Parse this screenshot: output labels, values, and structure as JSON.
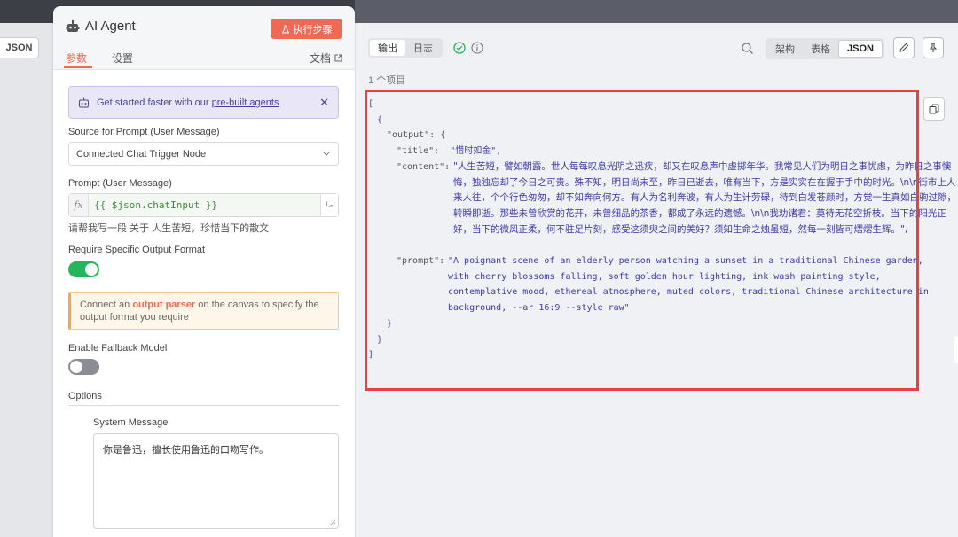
{
  "side_left": {
    "json_label": "JSON"
  },
  "panel": {
    "title": "AI Agent",
    "exec_button": "执行步骤",
    "tabs": {
      "params": "参数",
      "settings": "设置"
    },
    "docs_link": "文档",
    "tip": {
      "prefix": "Get started faster with our ",
      "link": "pre-built agents"
    },
    "source_label": "Source for Prompt (User Message)",
    "source_value": "Connected Chat Trigger Node",
    "prompt_label": "Prompt (User Message)",
    "prompt_expr": "{{ $json.chatInput }}",
    "prompt_hint": "请帮我写一段 关于 人生苦短，珍惜当下的散文",
    "require_format_label": "Require Specific Output Format",
    "require_format_on": true,
    "warn": {
      "p1": "Connect an ",
      "hl": "output parser",
      "p2": " on the canvas to specify the output format you require"
    },
    "fallback_label": "Enable Fallback Model",
    "fallback_on": false,
    "options_label": "Options",
    "system_message_label": "System Message",
    "system_message_value": "你是鲁迅，擅长使用鲁迅的口吻写作。"
  },
  "output": {
    "tabs": [
      "输出",
      "日志"
    ],
    "views": [
      "架构",
      "表格",
      "JSON"
    ],
    "active_view": "JSON",
    "item_count": "1 个项目",
    "json": {
      "open_bracket": "[",
      "open_brace": "{",
      "output_key": "\"output\": {",
      "title_key": "\"title\":",
      "title_val": "\"惜时如金\",",
      "content_key": "\"content\":",
      "content_val": "\"人生苦短，譬如朝露。世人每每叹息光阴之迅疾，却又在叹息声中虚掷年华。我常见人们为明日之事忧虑，为昨日之事懊悔，独独忘却了今日之可贵。殊不知，明日尚未至，昨日已逝去，唯有当下，方是实实在在握于手中的时光。\\n\\n街市上人来人往，个个行色匆匆，却不知奔向何方。有人为名利奔波，有人为生计劳碌，待到白发苍颜时，方觉一生真如白驹过隙，转瞬即逝。那些未曾欣赏的花开，未曾细品的茶香，都成了永远的遗憾。\\n\\n我劝诸君：莫待无花空折枝。当下的阳光正好，当下的微风正柔，何不驻足片刻，感受这须臾之间的美好？须知生命之烛虽短，然每一刻皆可熠熠生辉。\",",
      "prompt_key": "\"prompt\":",
      "prompt_val": "\"A poignant scene of an elderly person watching a sunset in a traditional Chinese garden, with cherry blossoms falling, soft golden hour lighting, ink wash painting style, contemplative mood, ethereal atmosphere, muted colors, traditional Chinese architecture in background, --ar 16:9 --style raw\"",
      "close_inner": "}",
      "close_brace": "}",
      "close_bracket": "]"
    }
  },
  "colors": {
    "accent": "#ef6a55",
    "toggle_on": "#25b55b",
    "highlight_frame": "#e64040"
  }
}
